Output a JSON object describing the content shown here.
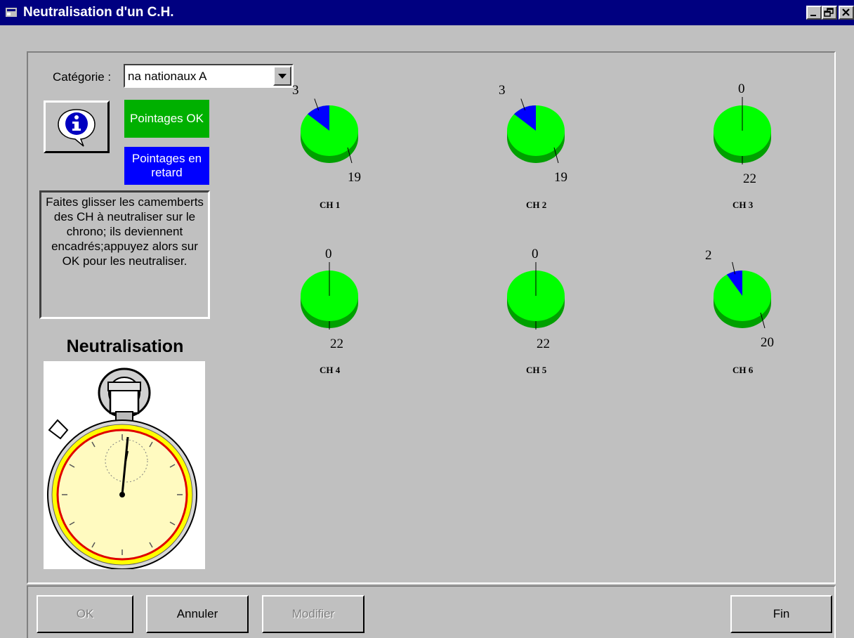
{
  "window": {
    "title": "Neutralisation d'un C.H.",
    "title_icon": "app-icon",
    "controls": [
      "minimize-icon",
      "restore-icon",
      "close-icon"
    ]
  },
  "category": {
    "label": "Catégorie :",
    "selected": "na  nationaux A"
  },
  "info_button_icon": "info-icon",
  "legend": {
    "ok": "Pointages OK",
    "late": "Pointages en retard"
  },
  "instructions": "Faites glisser les camemberts des CH à neutraliser sur le chrono; ils deviennent encadrés;appuyez alors sur OK pour les neutraliser.",
  "neutralisation": {
    "title": "Neutralisation",
    "image": "stopwatch-image"
  },
  "colors": {
    "ok": "#00ff00",
    "ok_dark": "#00a000",
    "late": "#0000ff",
    "badge_ok": "#00b000",
    "title_bar": "#000080"
  },
  "checkpoints": [
    {
      "label": "CH 1",
      "late": 3,
      "ok": 19
    },
    {
      "label": "CH 2",
      "late": 3,
      "ok": 19
    },
    {
      "label": "CH 3",
      "late": 0,
      "ok": 22
    },
    {
      "label": "CH 4",
      "late": 0,
      "ok": 22
    },
    {
      "label": "CH 5",
      "late": 0,
      "ok": 22
    },
    {
      "label": "CH 6",
      "late": 2,
      "ok": 20
    }
  ],
  "buttons": {
    "ok": "OK",
    "cancel": "Annuler",
    "modify": "Modifier",
    "end": "Fin"
  }
}
